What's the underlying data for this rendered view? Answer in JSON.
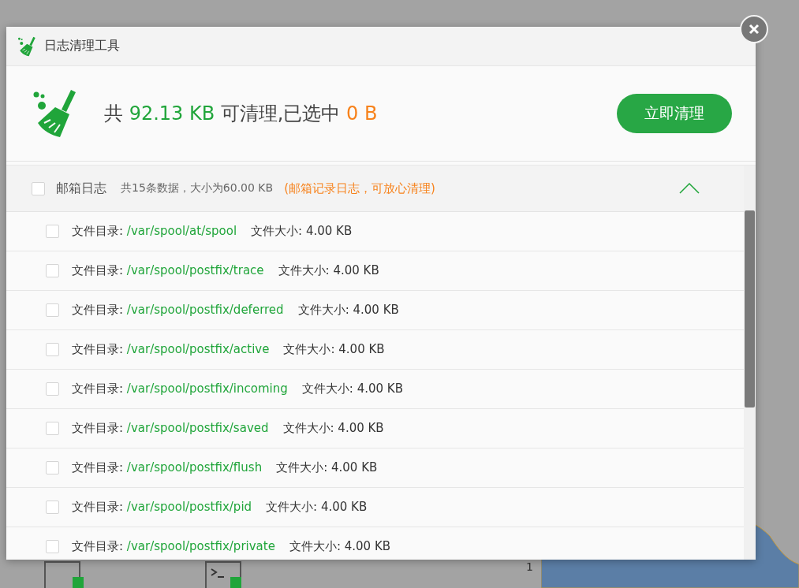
{
  "background": {
    "axis_label": "1"
  },
  "dialog": {
    "title": "日志清理工具",
    "summary": {
      "prefix": "共",
      "total": "92.13 KB",
      "middle": "可清理,已选中",
      "selected_size": "0 B"
    },
    "clean_button": "立即清理",
    "groups": [
      {
        "name": "邮箱日志",
        "info": "共15条数据，大小为60.00 KB",
        "note": "(邮箱记录日志，可放心清理)",
        "checked": false,
        "expanded": true,
        "files": [
          {
            "dir_label": "文件目录:",
            "path": "/var/spool/at/spool",
            "size_label": "文件大小:",
            "size": "4.00 KB",
            "checked": false
          },
          {
            "dir_label": "文件目录:",
            "path": "/var/spool/postfix/trace",
            "size_label": "文件大小:",
            "size": "4.00 KB",
            "checked": false
          },
          {
            "dir_label": "文件目录:",
            "path": "/var/spool/postfix/deferred",
            "size_label": "文件大小:",
            "size": "4.00 KB",
            "checked": false
          },
          {
            "dir_label": "文件目录:",
            "path": "/var/spool/postfix/active",
            "size_label": "文件大小:",
            "size": "4.00 KB",
            "checked": false
          },
          {
            "dir_label": "文件目录:",
            "path": "/var/spool/postfix/incoming",
            "size_label": "文件大小:",
            "size": "4.00 KB",
            "checked": false
          },
          {
            "dir_label": "文件目录:",
            "path": "/var/spool/postfix/saved",
            "size_label": "文件大小:",
            "size": "4.00 KB",
            "checked": false
          },
          {
            "dir_label": "文件目录:",
            "path": "/var/spool/postfix/flush",
            "size_label": "文件大小:",
            "size": "4.00 KB",
            "checked": false
          },
          {
            "dir_label": "文件目录:",
            "path": "/var/spool/postfix/pid",
            "size_label": "文件大小:",
            "size": "4.00 KB",
            "checked": false
          },
          {
            "dir_label": "文件目录:",
            "path": "/var/spool/postfix/private",
            "size_label": "文件大小:",
            "size": "4.00 KB",
            "checked": false
          }
        ]
      }
    ]
  }
}
